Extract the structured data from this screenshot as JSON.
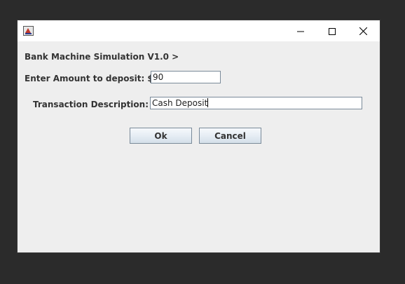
{
  "window": {
    "title": "",
    "controls": {
      "minimize": "minimize-icon",
      "maximize": "maximize-icon",
      "close": "close-icon"
    }
  },
  "header": {
    "title": "Bank Machine Simulation V1.0 >"
  },
  "form": {
    "amount_label": "Enter Amount to deposit: $",
    "amount_value": "90",
    "description_label": "Transaction Description:",
    "description_value": "Cash Deposit"
  },
  "buttons": {
    "ok_label": "Ok",
    "cancel_label": "Cancel"
  },
  "colors": {
    "window_bg": "#eeeeee",
    "titlebar_bg": "#ffffff",
    "desktop_bg": "#2b2b2b"
  }
}
